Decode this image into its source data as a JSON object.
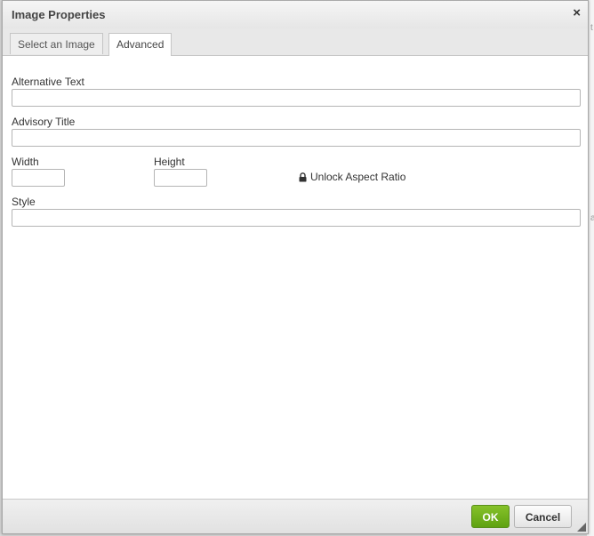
{
  "dialog": {
    "title": "Image Properties",
    "close_glyph": "×"
  },
  "tabs": [
    {
      "label": "Select an Image",
      "active": false
    },
    {
      "label": "Advanced",
      "active": true
    }
  ],
  "form": {
    "alt_text_label": "Alternative Text",
    "alt_text_value": "",
    "advisory_title_label": "Advisory Title",
    "advisory_title_value": "",
    "width_label": "Width",
    "width_value": "",
    "height_label": "Height",
    "height_value": "",
    "aspect_ratio_link": "Unlock Aspect Ratio",
    "style_label": "Style",
    "style_value": ""
  },
  "footer": {
    "ok_label": "OK",
    "cancel_label": "Cancel"
  },
  "colors": {
    "ok_button": "#6cb41b",
    "titlebar": "#eeeeee"
  }
}
